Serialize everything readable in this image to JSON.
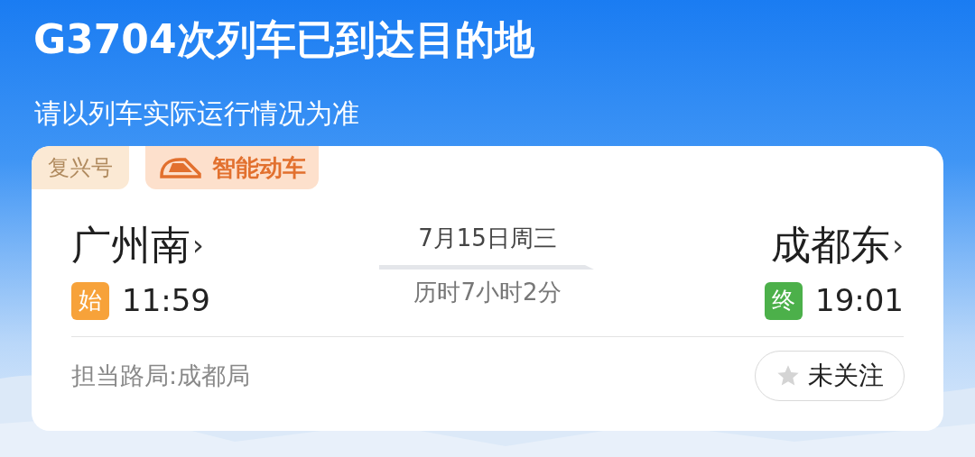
{
  "header": {
    "title": "G3704次列车已到达目的地",
    "subtitle": "请以列车实际运行情况为准"
  },
  "card": {
    "tags": [
      {
        "kind": "plain",
        "label": "复兴号"
      },
      {
        "kind": "train",
        "label": "智能动车"
      }
    ],
    "departure": {
      "station": "广州南",
      "chevron": "›",
      "badge": "始",
      "time": "11:59"
    },
    "middle": {
      "date": "7月15日周三",
      "duration": "历时7小时2分"
    },
    "arrival": {
      "station": "成都东",
      "chevron": "›",
      "badge": "终",
      "time": "19:01"
    },
    "bureau": "担当路局:成都局",
    "follow": {
      "label": "未关注",
      "followed": false
    }
  }
}
